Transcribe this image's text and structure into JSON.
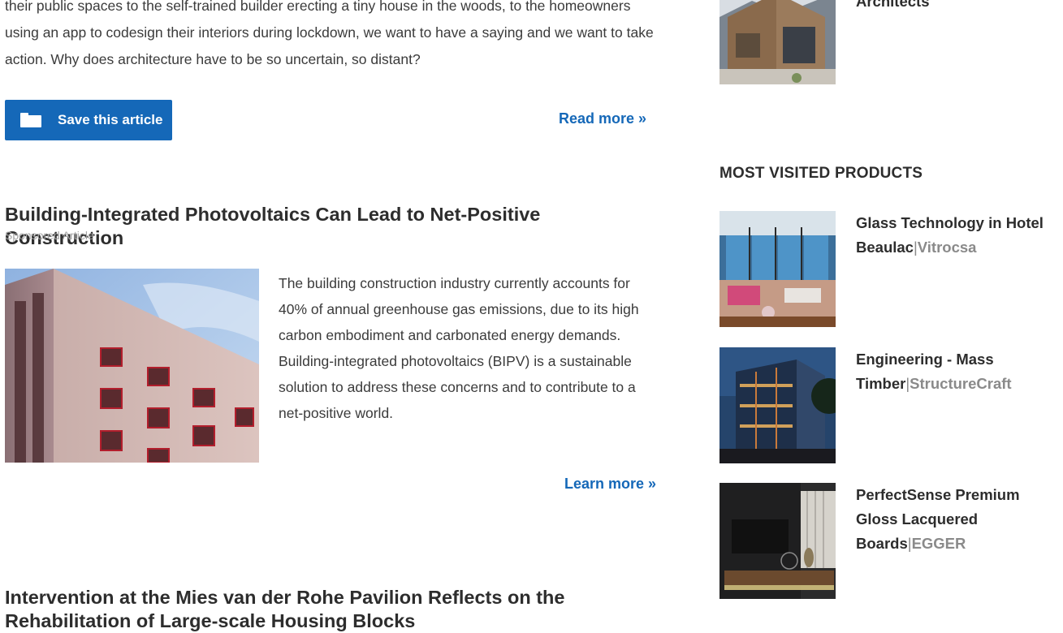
{
  "article_intro": {
    "text": "their public spaces to the self-trained builder erecting a tiny house in the woods, to the homeowners using an app to codesign their interiors during lockdown, we want to have a saying and we want to take action. Why does architecture have to be so uncertain, so distant?",
    "save_label": "Save this article",
    "read_more": "Read more »"
  },
  "bipv_article": {
    "title": "Building-Integrated Photovoltaics Can Lead to Net-Positive Construction",
    "tag": "Sponsored Article",
    "text": "The building construction industry currently accounts for 40% of annual greenhouse gas emissions, due to its high carbon embodiment and carbonated energy demands. Building-integrated photovoltaics (BIPV) is a sustainable solution to address these concerns and to contribute to a net-positive world.",
    "learn_more": "Learn more »"
  },
  "next_article": {
    "title": "Intervention at the Mies van der Rohe Pavilion Reflects on the Rehabilitation of Large-scale Housing Blocks"
  },
  "sidebar": {
    "top_item_label": "Architects",
    "section_title": "MOST VISITED PRODUCTS",
    "products": [
      {
        "name": "Glass Technology in Hotel Beaulac",
        "separator": "|",
        "brand": "Vitrocsa"
      },
      {
        "name": "Engineering - Mass Timber",
        "separator": "|",
        "brand": "StructureCraft"
      },
      {
        "name": "PerfectSense Premium Gloss Lacquered Boards",
        "separator": "|",
        "brand": "EGGER"
      }
    ]
  },
  "colors": {
    "accent": "#1568b8",
    "brand_gray": "#8a8a8a",
    "title": "#2d2d2d",
    "sponsored": "#a5a5a5"
  },
  "icons": {
    "save": "folder-icon"
  }
}
